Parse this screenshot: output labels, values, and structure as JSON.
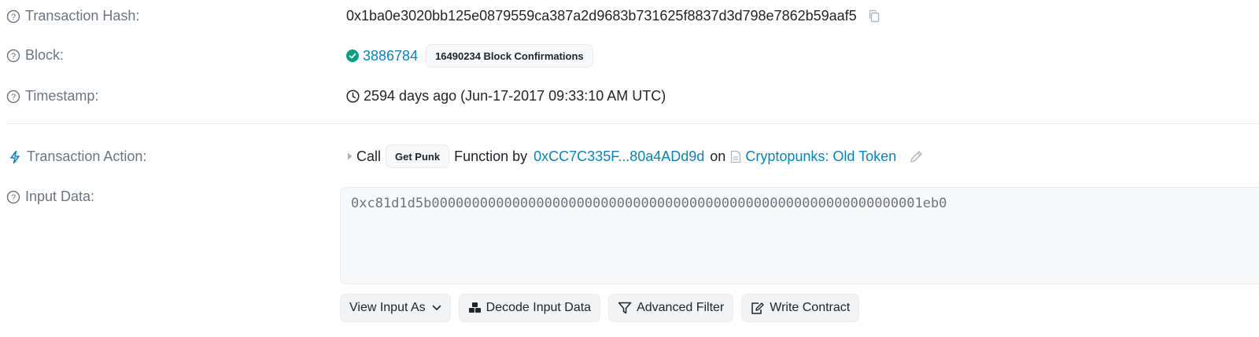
{
  "tx_hash": {
    "label": "Transaction Hash:",
    "value": "0x1ba0e3020bb125e0879559ca387a2d9683b731625f8837d3d798e7862b59aaf5",
    "icons": {
      "help": "question-circle-icon",
      "copy": "copy-icon"
    }
  },
  "block": {
    "label": "Block:",
    "number": "3886784",
    "confirmations": "16490234 Block Confirmations",
    "status_color": "#00a186"
  },
  "timestamp": {
    "label": "Timestamp:",
    "value": "2594 days ago (Jun-17-2017 09:33:10 AM UTC)"
  },
  "action": {
    "label": "Transaction Action:",
    "call": "Call",
    "method": "Get Punk",
    "function_by": "Function by",
    "from": "0xCC7C335F...80a4ADd9d",
    "on": "on",
    "contract": "Cryptopunks: Old Token",
    "icons": {
      "bolt": "lightning-icon",
      "file": "file-icon",
      "edit": "pencil-icon",
      "expand": "caret-right-icon"
    }
  },
  "input_data": {
    "label": "Input Data:",
    "value": "0xc81d1d5b0000000000000000000000000000000000000000000000000000000000001eb0"
  },
  "buttons": {
    "view_input": "View Input As",
    "decode": "Decode Input Data",
    "advanced_filter": "Advanced Filter",
    "write_contract": "Write Contract"
  },
  "colors": {
    "link": "#0784c3",
    "muted": "#6c757d",
    "success": "#00a186"
  }
}
